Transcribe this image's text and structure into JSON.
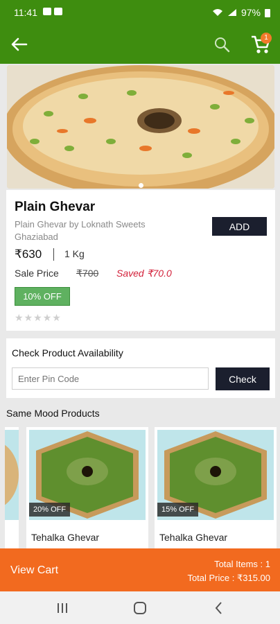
{
  "status_bar": {
    "time": "11:41",
    "battery": "97%"
  },
  "app_bar": {
    "cart_count": "1"
  },
  "product": {
    "title": "Plain Ghevar",
    "subtitle": "Plain Ghevar by Loknath Sweets Ghaziabad",
    "add_label": "ADD",
    "price": "₹630",
    "weight": "1 Kg",
    "sale_price_label": "Sale Price",
    "mrp": "₹700",
    "saved": "Saved ₹70.0",
    "discount": "10% OFF",
    "rating": 0,
    "rating_max": 5
  },
  "availability": {
    "title": "Check Product Availability",
    "placeholder": "Enter Pin Code",
    "check_label": "Check"
  },
  "same_mood": {
    "title": "Same Mood Products",
    "items": [
      {
        "name": "Tehalka Ghevar",
        "discount": "20% OFF"
      },
      {
        "name": "Tehalka Ghevar",
        "discount": "15% OFF"
      }
    ]
  },
  "cart_bar": {
    "view_cart": "View Cart",
    "total_items": "Total Items : 1",
    "total_price": "Total Price : ₹315.00"
  },
  "colors": {
    "primary_green": "#3e8d0f",
    "accent_orange": "#f26a1f",
    "dark_button": "#1b1f2e",
    "saved_red": "#d3213a"
  }
}
